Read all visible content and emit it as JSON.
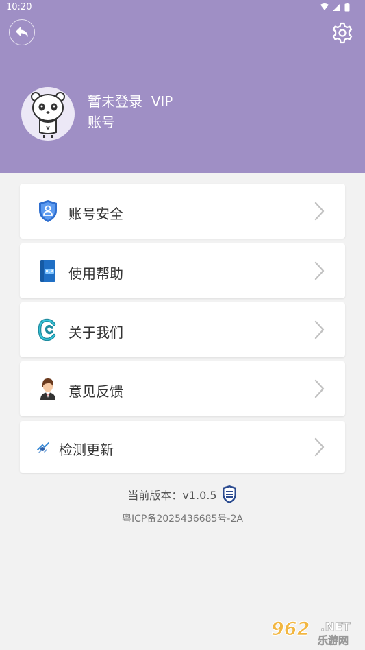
{
  "status_bar": {
    "time": "10:20"
  },
  "header": {
    "user_status": "暂未登录",
    "vip_label": "VIP",
    "account_label": "账号",
    "accent_color": "#9f8fc5"
  },
  "menu": [
    {
      "label": "账号安全",
      "icon": "shield-icon"
    },
    {
      "label": "使用帮助",
      "icon": "help-book-icon"
    },
    {
      "label": "关于我们",
      "icon": "c-logo-icon"
    },
    {
      "label": "意见反馈",
      "icon": "support-agent-icon"
    },
    {
      "label": "检测更新",
      "icon": "update-icon"
    }
  ],
  "footer": {
    "version_label": "当前版本：",
    "version": "v1.0.5",
    "icp": "粤ICP备2025436685号-2A"
  },
  "watermark": {
    "logo": "962",
    "domain": ".NET",
    "name": "乐游网"
  }
}
